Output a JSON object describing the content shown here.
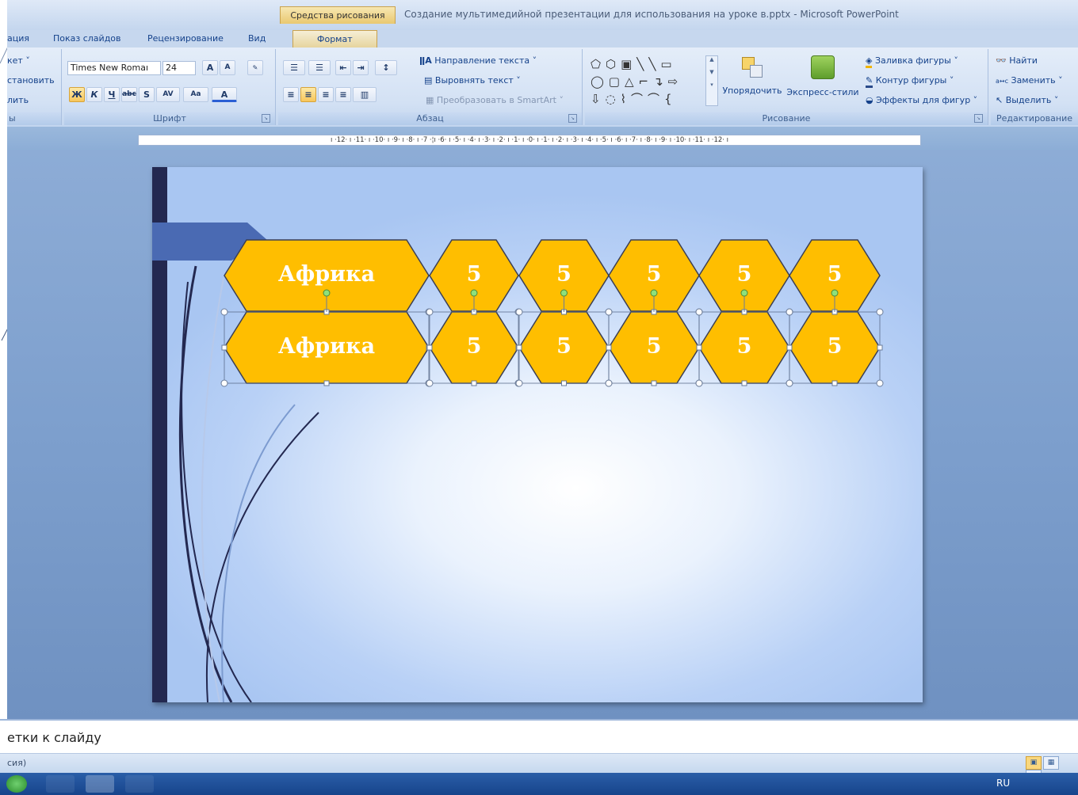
{
  "titlebar": {
    "context_tab": "Средства рисования",
    "title": "Создание мультимедийной презентации для использования на уроке в.pptx - Microsoft PowerPoint"
  },
  "tabs": [
    "ация",
    "Показ слайдов",
    "Рецензирование",
    "Вид",
    "Формат"
  ],
  "ribbon": {
    "clipboard": {
      "layout": "кет ˅",
      "reset": "становить",
      "delete": "лить",
      "label": "ы"
    },
    "font": {
      "font_name": "Times New Romaı",
      "font_size": "24",
      "label": "Шрифт"
    },
    "paragraph": {
      "text_direction": "Направление текста ˅",
      "align_text": "Выровнять текст ˅",
      "convert_smartart": "Преобразовать в SmartArt ˅",
      "label": "Абзац"
    },
    "drawing": {
      "arrange": "Упорядочить",
      "quick_styles": "Экспресс-стили",
      "shape_fill": "Заливка фигуры ˅",
      "shape_outline": "Контур фигуры ˅",
      "shape_effects": "Эффекты для фигур ˅",
      "label": "Рисование"
    },
    "editing": {
      "find": "Найти",
      "replace": "Заменить ˅",
      "select": "Выделить ˅",
      "label": "Редактирование"
    }
  },
  "ruler_text": "ı ·12· ı ·11· ı ·10· ı ·9· ı ·8· ı ·7 ·¦ı ·6· ı ·5· ı ·4· ı ·3· ı ·2· ı ·1· ı ·0· ı ·1· ı ·2· ı ·3· ı ·4· ı ·5· ı ·6· ı ·7· ı ·8· ı ·9· ı ·10· ı ·11· ı ·12· ı",
  "slide": {
    "row1": [
      "Африка",
      "5",
      "5",
      "5",
      "5",
      "5"
    ],
    "row2": [
      "Африка",
      "5",
      "5",
      "5",
      "5",
      "5"
    ],
    "hex_fill": "#FFBE00"
  },
  "notes": "етки к слайду",
  "status": "сия)",
  "taskbar": {
    "lang": "RU"
  }
}
